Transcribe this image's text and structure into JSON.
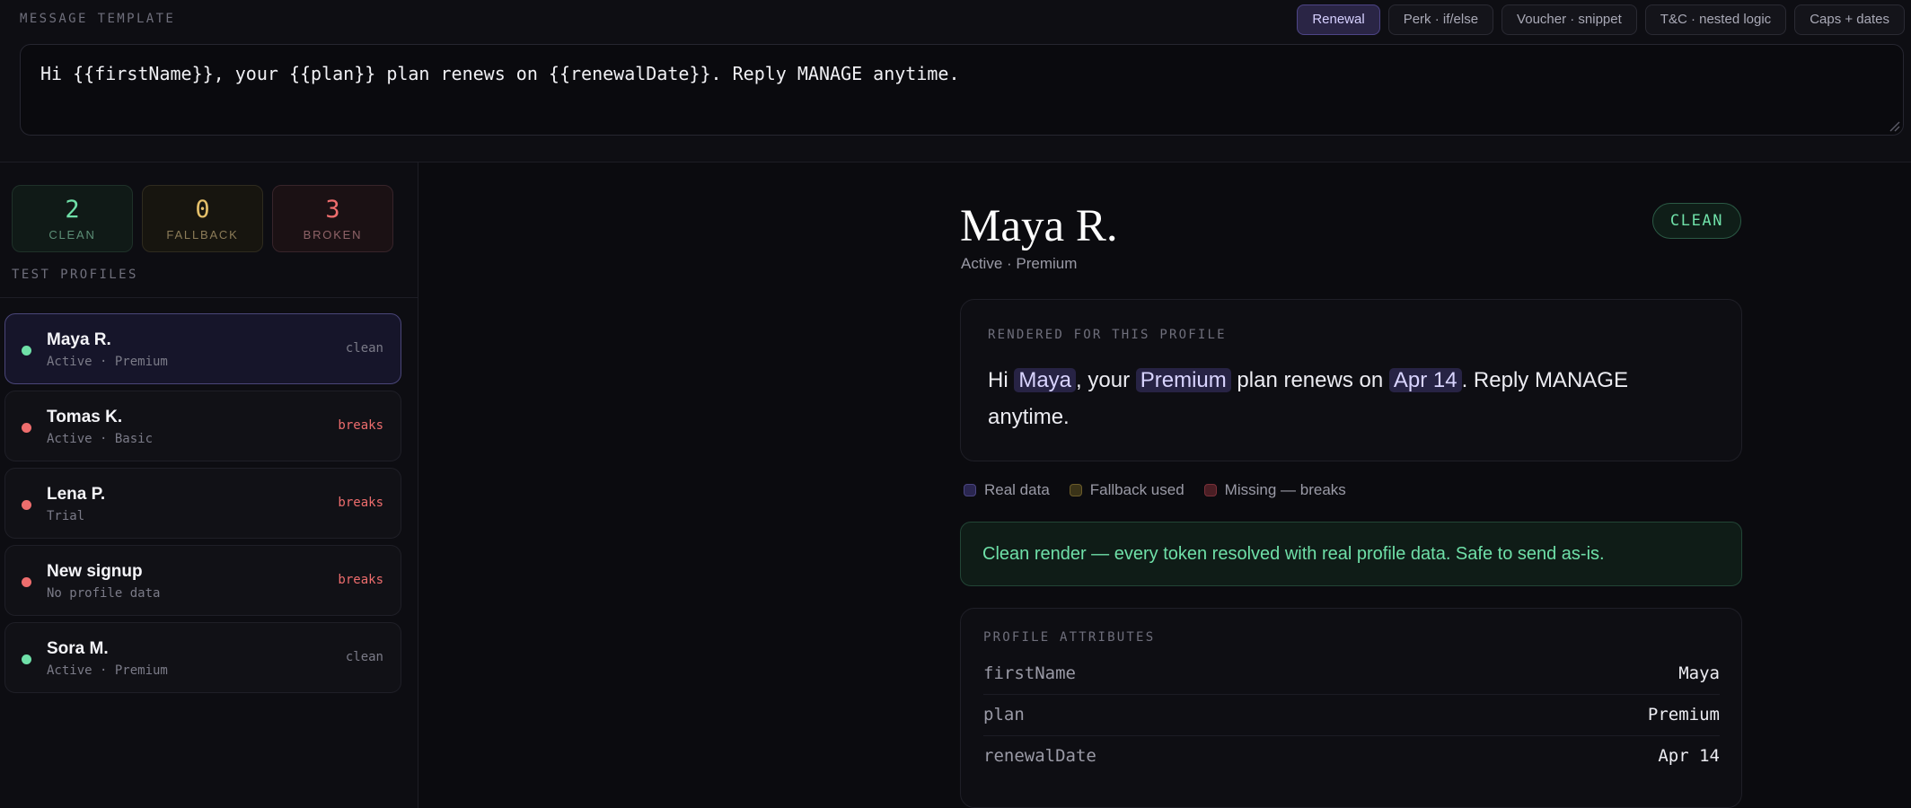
{
  "template": {
    "label": "MESSAGE TEMPLATE",
    "text": "Hi {{firstName}}, your {{plan}} plan renews on {{renewalDate}}. Reply MANAGE anytime."
  },
  "presets": [
    {
      "label": "Renewal",
      "active": true
    },
    {
      "label": "Perk · if/else",
      "active": false
    },
    {
      "label": "Voucher · snippet",
      "active": false
    },
    {
      "label": "T&C · nested logic",
      "active": false
    },
    {
      "label": "Caps + dates",
      "active": false
    }
  ],
  "stats": {
    "clean": {
      "count": "2",
      "label": "CLEAN"
    },
    "fallback": {
      "count": "0",
      "label": "FALLBACK"
    },
    "broken": {
      "count": "3",
      "label": "BROKEN"
    }
  },
  "profiles_label": "TEST PROFILES",
  "profiles": [
    {
      "name": "Maya R.",
      "sub": "Active · Premium",
      "status": "clean"
    },
    {
      "name": "Tomas K.",
      "sub": "Active · Basic",
      "status": "breaks"
    },
    {
      "name": "Lena P.",
      "sub": "Trial",
      "status": "breaks"
    },
    {
      "name": "New signup",
      "sub": "No profile data",
      "status": "breaks"
    },
    {
      "name": "Sora M.",
      "sub": "Active · Premium",
      "status": "clean"
    }
  ],
  "detail": {
    "name": "Maya R.",
    "meta": "Active · Premium",
    "status_pill": "CLEAN",
    "rendered_label": "RENDERED FOR THIS PROFILE",
    "rendered": {
      "p1": "Hi ",
      "t1": "Maya",
      "p2": ", your ",
      "t2": "Premium",
      "p3": " plan renews on ",
      "t3": "Apr 14",
      "p4": ". Reply MANAGE anytime."
    },
    "legend": {
      "real": "Real data",
      "fallback": "Fallback used",
      "missing": "Missing — breaks"
    },
    "banner": "Clean render — every token resolved with real profile data. Safe to send as-is.",
    "attributes_label": "PROFILE ATTRIBUTES",
    "attributes": [
      {
        "key": "firstName",
        "value": "Maya"
      },
      {
        "key": "plan",
        "value": "Premium"
      },
      {
        "key": "renewalDate",
        "value": "Apr 14"
      }
    ]
  },
  "colors": {
    "clean": "#6fe0a8",
    "fallback": "#e5c06a",
    "broken": "#ee6d6d",
    "accent": "#4d4587"
  }
}
